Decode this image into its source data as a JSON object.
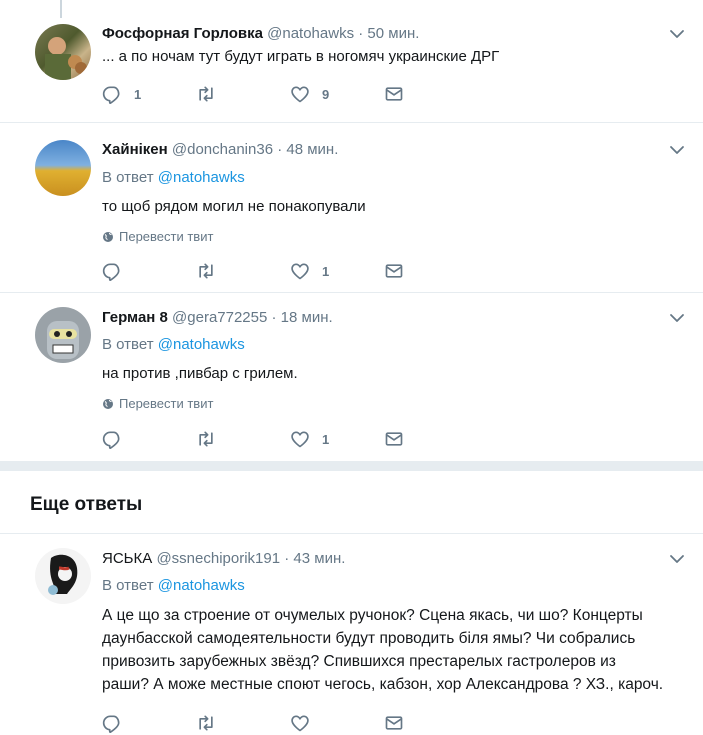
{
  "tweets": [
    {
      "name": "Фосфорная Горловка",
      "handle": "@natohawks",
      "time": "· 50 мин.",
      "text": "... а по ночам тут будут играть в ногомяч украинские ДРГ",
      "replies": "1",
      "retweets": "",
      "likes": "9"
    },
    {
      "name": "Хайнікен",
      "handle": "@donchanin36",
      "time": "· 48 мин.",
      "reply_prefix": "В ответ",
      "reply_handle": "@natohawks",
      "text": "то щоб рядом могил не понакопували",
      "translate": "Перевести твит",
      "replies": "",
      "retweets": "",
      "likes": "1"
    },
    {
      "name": "Герман 8",
      "handle": "@gera772255",
      "time": "· 18 мин.",
      "reply_prefix": "В ответ",
      "reply_handle": "@natohawks",
      "text": "на против ,пивбар с грилем.",
      "translate": "Перевести твит",
      "replies": "",
      "retweets": "",
      "likes": "1"
    },
    {
      "name": "ЯСЬКА",
      "handle": "@ssnechiporik191",
      "time": "· 43 мин.",
      "reply_prefix": "В ответ",
      "reply_handle": "@natohawks",
      "text_lines": [
        "А це що за строение от очумелых ручонок? Сцена якась, чи шо? Концерты",
        "даунбасской самодеятельности будут проводить біля ямы? Чи собрались",
        "привозить зарубежных звёзд? Спившихся престарелых гастролеров из",
        "раши? А може местные споют чегось, кабзон, хор Александрова ? ХЗ., кароч."
      ]
    }
  ],
  "more_replies_title": "Еще ответы",
  "icons": {
    "reply": "reply-icon",
    "retweet": "retweet-icon",
    "like": "heart-icon",
    "dm": "envelope-icon",
    "caret": "chevron-down-icon",
    "globe": "globe-icon"
  },
  "colors": {
    "link": "#1b95e0",
    "muted": "#657786",
    "separator": "#e6ecf0"
  }
}
